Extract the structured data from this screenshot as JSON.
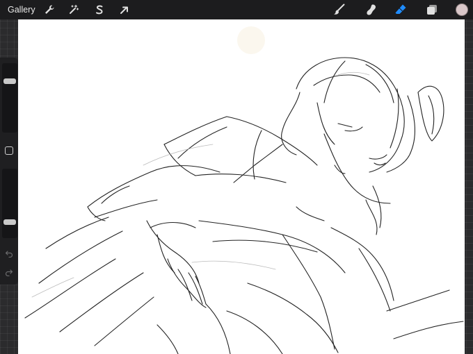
{
  "topbar": {
    "gallery_label": "Gallery",
    "left_tools": [
      {
        "name": "actions",
        "icon": "wrench-icon"
      },
      {
        "name": "adjustments",
        "icon": "magic-wand-icon"
      },
      {
        "name": "selection",
        "icon": "selection-s-icon"
      },
      {
        "name": "transform",
        "icon": "arrow-cursor-icon"
      }
    ],
    "right_tools": [
      {
        "name": "brush",
        "icon": "brush-icon"
      },
      {
        "name": "smudge",
        "icon": "smudge-finger-icon"
      },
      {
        "name": "eraser",
        "icon": "eraser-icon",
        "active": true,
        "color": "#1f8cff"
      },
      {
        "name": "layers",
        "icon": "layers-icon"
      }
    ],
    "color_swatch": "#d9c7c9"
  },
  "sidebar": {
    "brush_size": 0.92,
    "opacity": 0.35,
    "modify_button_icon": "square-icon",
    "undo_icon": "undo-arrow-icon",
    "redo_icon": "redo-arrow-icon"
  },
  "canvas": {
    "background": "#ffffff",
    "content": "line-art-sketch"
  },
  "colors": {
    "toolbar_bg": "#1c1c1e",
    "workspace_bg": "#2b2b2d",
    "active_tool": "#1f8cff",
    "icon": "#e0e0e0"
  }
}
